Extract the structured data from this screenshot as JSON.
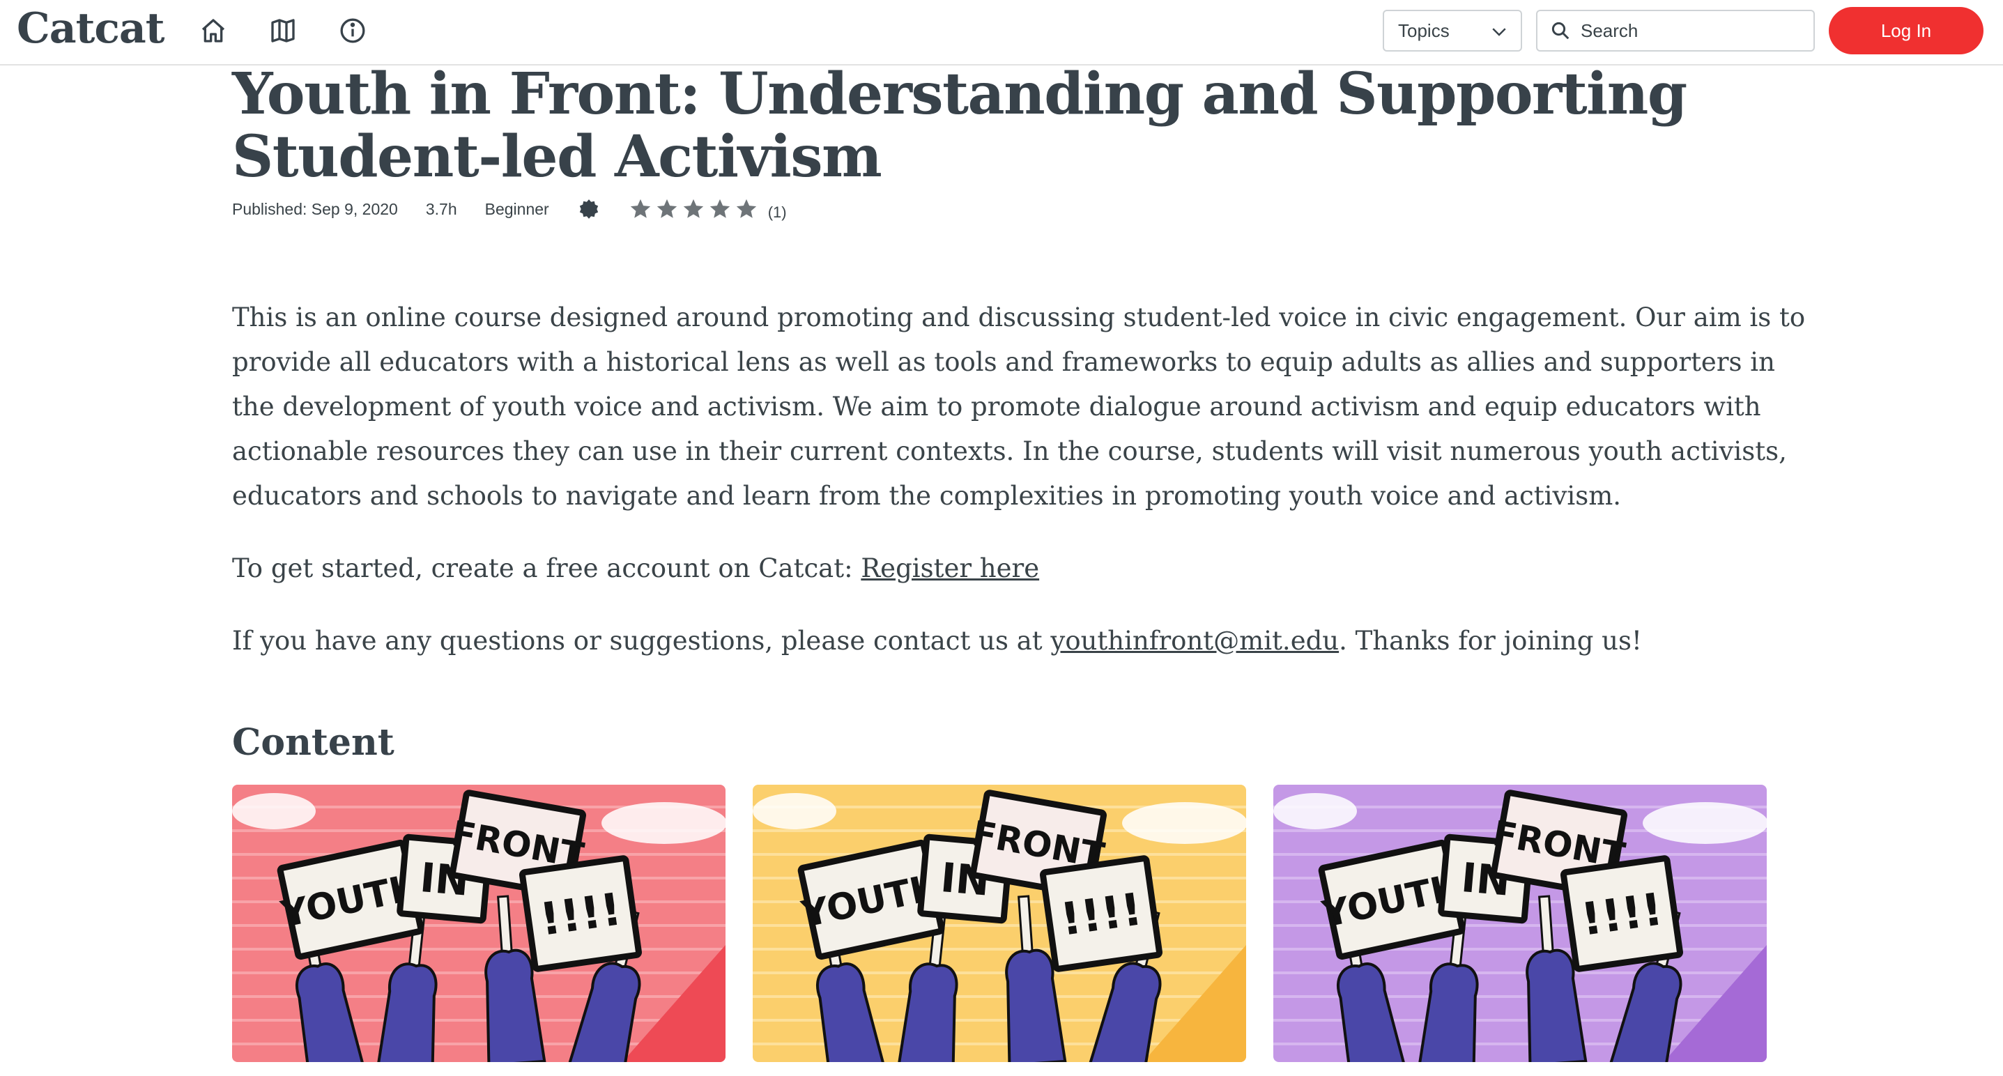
{
  "header": {
    "logo": "Catcat",
    "nav_icons": [
      "home-icon",
      "map-icon",
      "info-icon"
    ],
    "topics_label": "Topics",
    "search_placeholder": "Search",
    "login_label": "Log In"
  },
  "course": {
    "title": "Youth in Front: Understanding and Supporting Student-led Activism",
    "published": "Published: Sep 9, 2020",
    "duration": "3.7h",
    "level": "Beginner",
    "rating_stars": 5,
    "rating_count": "(1)",
    "description": "This is an online course designed around promoting and discussing student-led voice in civic engagement. Our aim is to provide all educators with a historical lens as well as tools and frameworks to equip adults as allies and supporters in the development of youth voice and activism. We aim to promote dialogue around activism and equip educators with actionable resources they can use in their current contexts. In the course, students will visit numerous youth activists, educators and schools to navigate and learn from the complexities in promoting youth voice and activism.",
    "register_prefix": "To get started, create a free account on Catcat: ",
    "register_link": "Register here",
    "contact_prefix": "If you have any questions or suggestions, please contact us at ",
    "contact_email": "youthinfront@mit.edu",
    "contact_suffix": ". Thanks for joining us!"
  },
  "content": {
    "heading": "Content",
    "cards": [
      {
        "bg": "#f47f86",
        "stripe": "#f8a3a8",
        "corner": "#ee4a55"
      },
      {
        "bg": "#fbcf6c",
        "stripe": "#fde09b",
        "corner": "#f7b53e"
      },
      {
        "bg": "#c498e6",
        "stripe": "#d6b6ef",
        "corner": "#a56ad6"
      }
    ]
  },
  "colors": {
    "accent": "#f03030",
    "text": "#3a4348"
  }
}
